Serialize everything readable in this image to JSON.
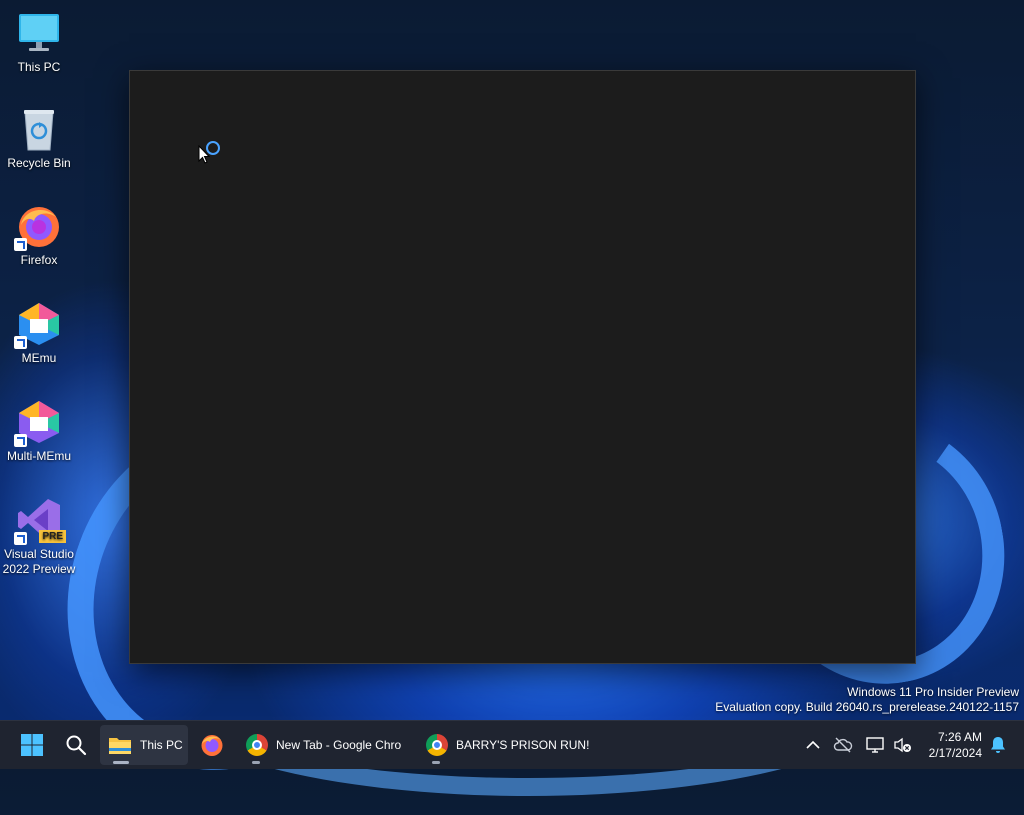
{
  "desktop": {
    "icons": [
      {
        "label": "This PC",
        "icon": "monitor-icon"
      },
      {
        "label": "Recycle Bin",
        "icon": "recycle-bin-icon"
      },
      {
        "label": "Firefox",
        "icon": "firefox-icon"
      },
      {
        "label": "MEmu",
        "icon": "memu-icon"
      },
      {
        "label": "Multi-MEmu",
        "icon": "multi-memu-icon"
      },
      {
        "label": "Visual Studio 2022 Preview",
        "line1": "Visual Studio",
        "line2": "2022 Preview",
        "badge": "PRE",
        "icon": "visual-studio-icon"
      }
    ]
  },
  "watermark": {
    "line1": "Windows 11 Pro Insider Preview",
    "line2": "Evaluation copy. Build 26040.rs_prerelease.240122-1157"
  },
  "taskbar": {
    "start_icon": "windows-start-icon",
    "search_icon": "search-icon",
    "apps": [
      {
        "label": "This PC",
        "icon": "file-explorer-icon",
        "active": true
      },
      {
        "label": "",
        "icon": "firefox-icon",
        "active": false
      },
      {
        "label": "New Tab - Google Chro",
        "icon": "chrome-icon",
        "active": false
      },
      {
        "label": "BARRY'S PRISON RUN! (",
        "icon": "chrome-icon",
        "active": false
      }
    ],
    "tray": {
      "icons": [
        "chevron-up-icon",
        "cloud-offline-icon",
        "network-icon",
        "volume-muted-icon",
        "notification-bell-icon"
      ],
      "time": "7:26 AM",
      "date": "2/17/2024"
    }
  },
  "colors": {
    "taskbar_bg": "#1f2430",
    "window_bg": "#1c1c1c",
    "accent": "#4aa3ff"
  }
}
